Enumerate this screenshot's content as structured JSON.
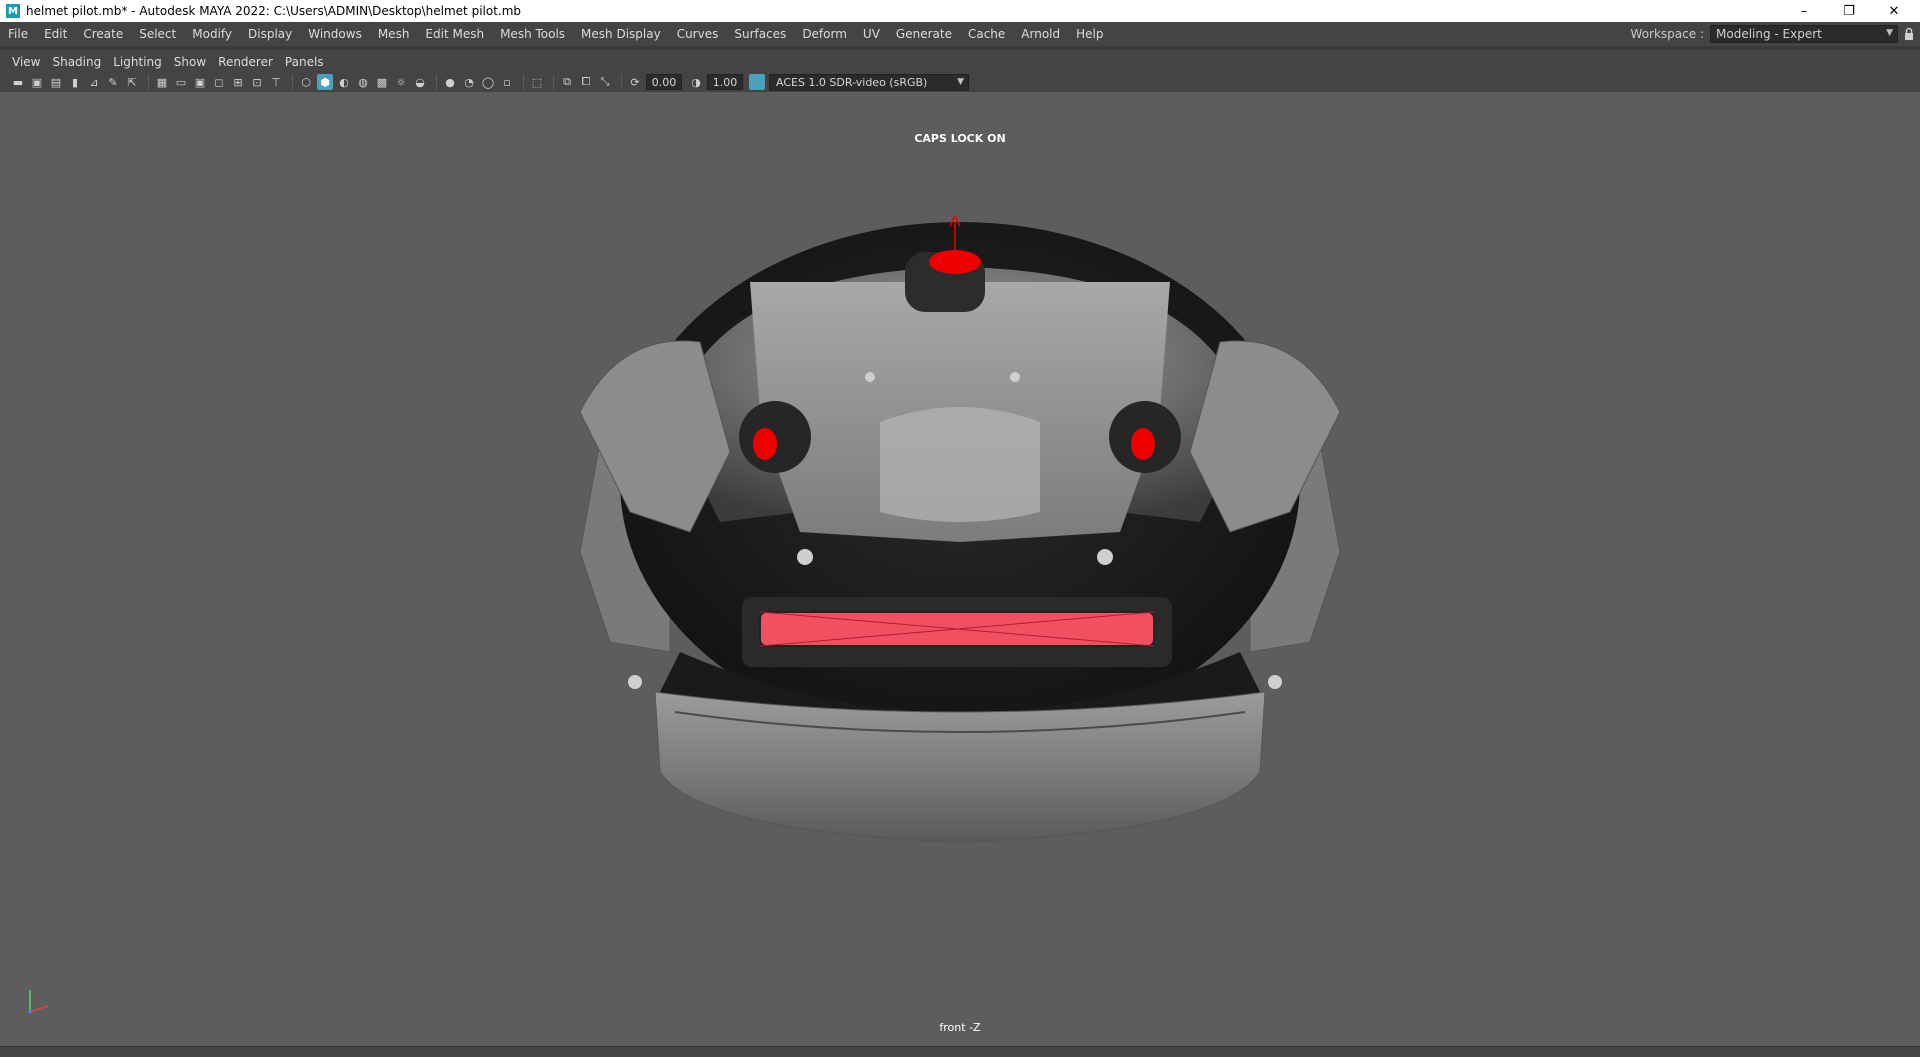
{
  "window": {
    "title": "helmet pilot.mb* - Autodesk MAYA 2022: C:\\Users\\ADMIN\\Desktop\\helmet pilot.mb",
    "icon_letter": "M",
    "minimize": "–",
    "maximize": "❐",
    "close": "✕"
  },
  "menubar": {
    "items": [
      "File",
      "Edit",
      "Create",
      "Select",
      "Modify",
      "Display",
      "Windows",
      "Mesh",
      "Edit Mesh",
      "Mesh Tools",
      "Mesh Display",
      "Curves",
      "Surfaces",
      "Deform",
      "UV",
      "Generate",
      "Cache",
      "Arnold",
      "Help"
    ],
    "workspace_label": "Workspace :",
    "workspace_value": "Modeling - Expert",
    "lock_icon": "lock-icon"
  },
  "panel_menu": {
    "items": [
      "View",
      "Shading",
      "Lighting",
      "Show",
      "Renderer",
      "Panels"
    ]
  },
  "toolbar": {
    "exposure": "0.00",
    "gamma": "1.00",
    "color_management": "ACES 1.0 SDR-video (sRGB)"
  },
  "viewport": {
    "hud_message": "CAPS LOCK ON",
    "camera_label": "front -Z",
    "background_color": "#5d5d5d",
    "selection_color": "#ff0000"
  }
}
